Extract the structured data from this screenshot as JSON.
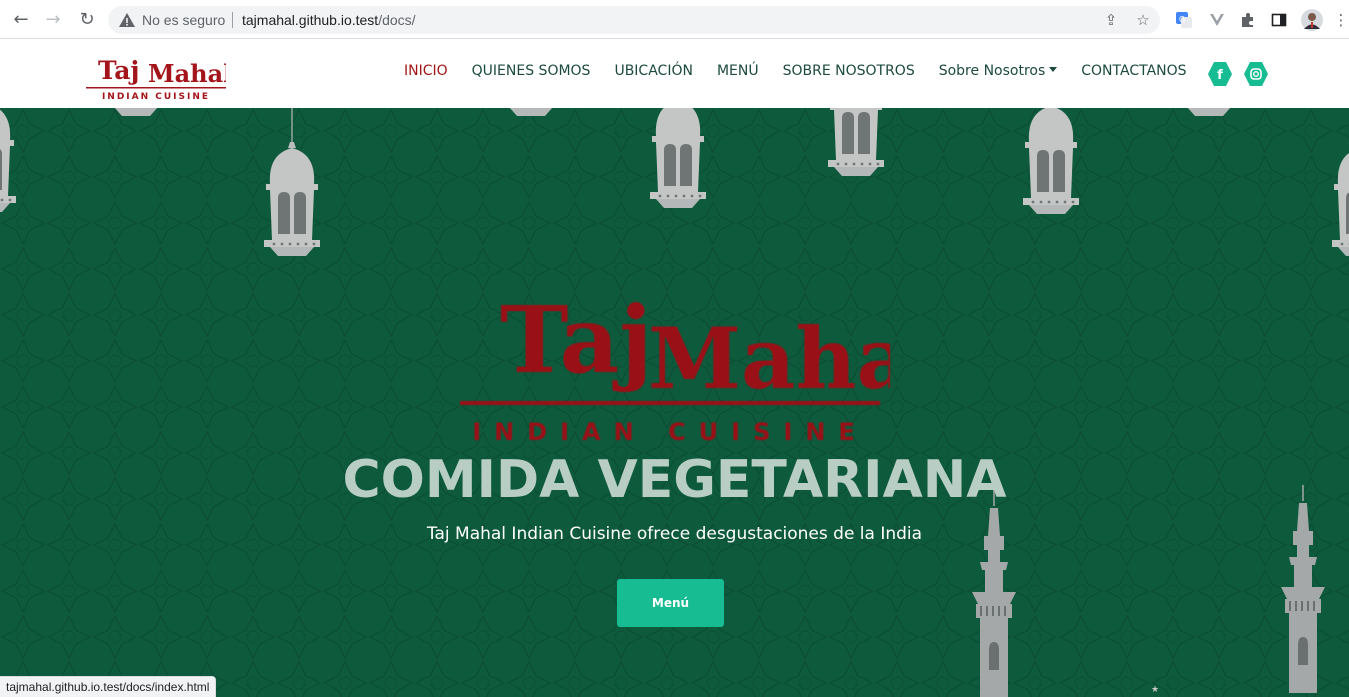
{
  "browser": {
    "security_label": "No es seguro",
    "url_host": "tajmahal.github.io.test",
    "url_path": "/docs/",
    "status_url": "tajmahal.github.io.test/docs/index.html"
  },
  "logo": {
    "brand": "Taj Mahal",
    "tagline": "INDIAN CUISINE"
  },
  "nav": {
    "items": [
      {
        "label": "INICIO",
        "active": true
      },
      {
        "label": "QUIENES SOMOS"
      },
      {
        "label": "UBICACIÓN"
      },
      {
        "label": "MENÚ"
      },
      {
        "label": "SOBRE NOSOTROS"
      },
      {
        "label": "Sobre Nosotros"
      },
      {
        "label": "CONTACTANOS"
      }
    ],
    "social": [
      {
        "icon": "facebook-icon",
        "glyph": "f"
      },
      {
        "icon": "instagram-icon",
        "glyph": "◎"
      }
    ]
  },
  "hero": {
    "title": "COMIDA VEGETARIANA",
    "subtitle": "Taj Mahal Indian Cuisine ofrece desgustaciones de la India",
    "button_label": "Menú"
  },
  "colors": {
    "hero_bg": "#0e5a3c",
    "accent": "#18bc93",
    "brand_red": "#a11616",
    "nav_text": "#1c4a3e"
  }
}
